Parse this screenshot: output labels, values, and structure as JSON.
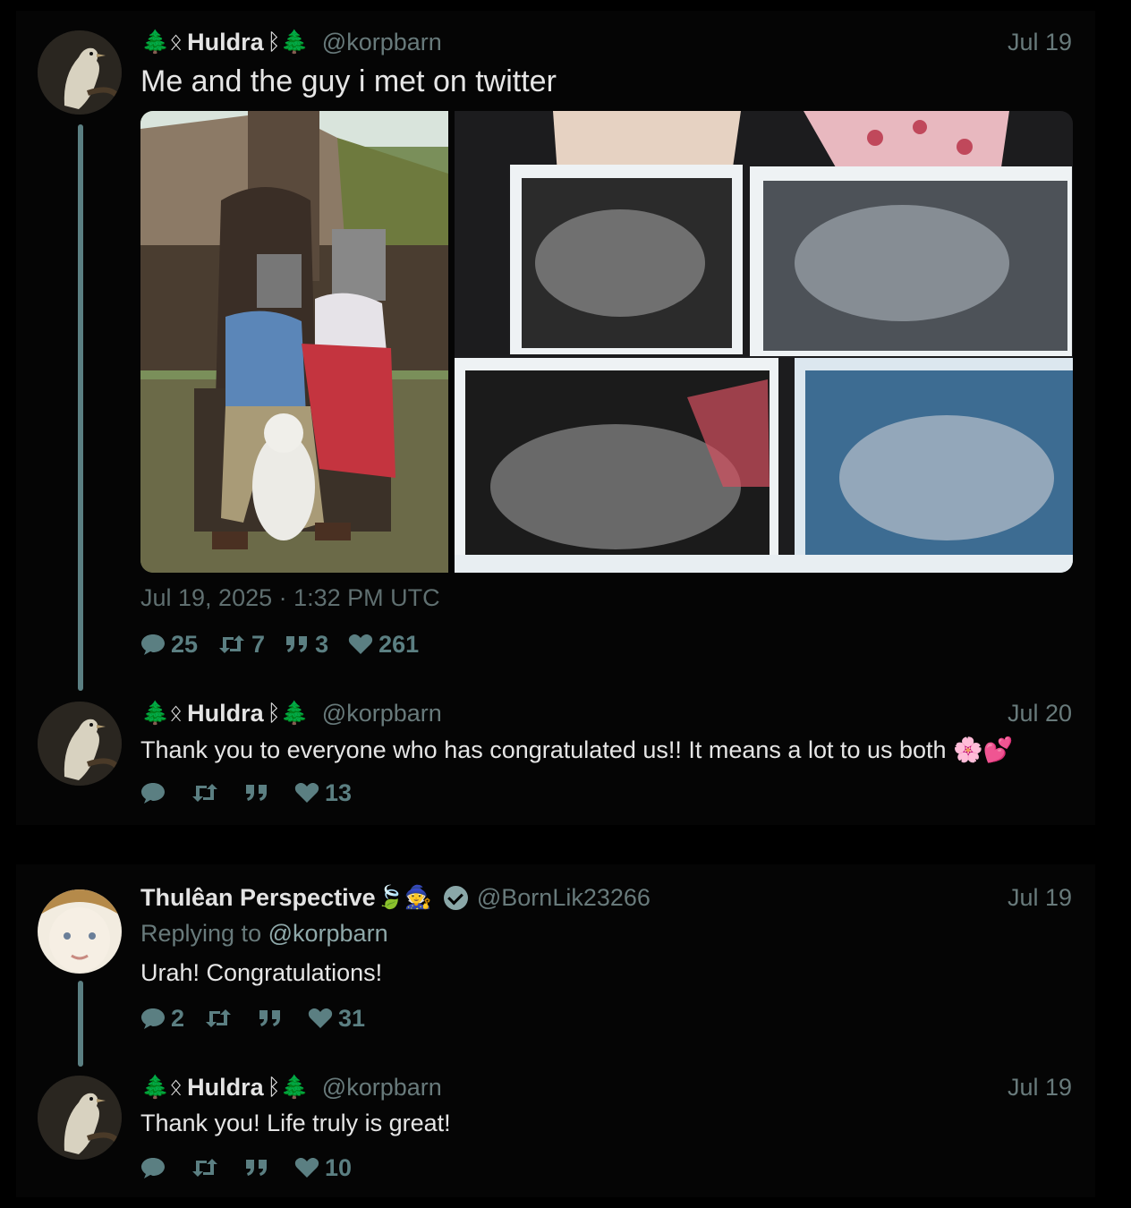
{
  "tweets": [
    {
      "name_prefix": "🌲ᛟ",
      "name": "Huldra",
      "name_suffix": "ᛒ🌲",
      "handle": "@korpbarn",
      "date": "Jul 19",
      "text": "Me and the guy i met on twitter",
      "timestamp": "Jul 19, 2025 · 1:32 PM UTC",
      "stats": {
        "comments": "25",
        "retweets": "7",
        "quotes": "3",
        "likes": "261"
      }
    },
    {
      "name_prefix": "🌲ᛟ",
      "name": "Huldra",
      "name_suffix": "ᛒ🌲",
      "handle": "@korpbarn",
      "date": "Jul 20",
      "text": "Thank you to everyone who has congratulated us!! It means a lot to us both 🌸💕",
      "stats": {
        "comments": "",
        "retweets": "",
        "quotes": "",
        "likes": "13"
      }
    },
    {
      "name": "Thulêan Perspective",
      "name_suffix": "🍃🧙",
      "handle": "@BornLik23266",
      "date": "Jul 19",
      "replying_label": "Replying to",
      "replying_to": "@korpbarn",
      "text": "Urah! Congratulations!",
      "stats": {
        "comments": "2",
        "retweets": "",
        "quotes": "",
        "likes": "31"
      }
    },
    {
      "name_prefix": "🌲ᛟ",
      "name": "Huldra",
      "name_suffix": "ᛒ🌲",
      "handle": "@korpbarn",
      "date": "Jul 19",
      "text": "Thank you! Life truly is great!",
      "stats": {
        "comments": "",
        "retweets": "",
        "quotes": "",
        "likes": "10"
      }
    }
  ],
  "colors": {
    "background": "#000000",
    "muted": "#687a7b",
    "accent": "#5b7f82",
    "text": "#e6e6e6"
  },
  "icons": [
    "comment-icon",
    "retweet-icon",
    "quote-icon",
    "heart-icon",
    "verified-icon"
  ]
}
